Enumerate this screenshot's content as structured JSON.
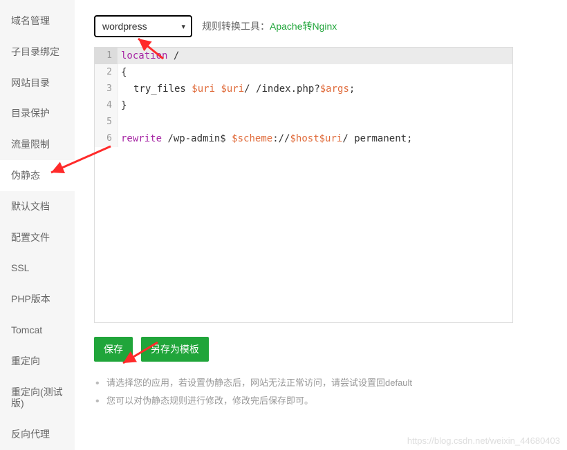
{
  "sidebar": {
    "items": [
      {
        "label": "域名管理"
      },
      {
        "label": "子目录绑定"
      },
      {
        "label": "网站目录"
      },
      {
        "label": "目录保护"
      },
      {
        "label": "流量限制"
      },
      {
        "label": "伪静态"
      },
      {
        "label": "默认文档"
      },
      {
        "label": "配置文件"
      },
      {
        "label": "SSL"
      },
      {
        "label": "PHP版本"
      },
      {
        "label": "Tomcat"
      },
      {
        "label": "重定向"
      },
      {
        "label": "重定向(测试版)"
      },
      {
        "label": "反向代理"
      }
    ],
    "active_index": 5
  },
  "top": {
    "select_value": "wordpress",
    "tool_label": "规则转换工具：",
    "tool_link": "Apache转Nginx"
  },
  "code_lines": [
    {
      "n": 1,
      "segments": [
        {
          "t": "location",
          "cls": "kw"
        },
        {
          "t": " /",
          "cls": ""
        }
      ],
      "indent": false,
      "first": true
    },
    {
      "n": 2,
      "segments": [
        {
          "t": "{",
          "cls": ""
        }
      ],
      "indent": false
    },
    {
      "n": 3,
      "segments": [
        {
          "t": "try_files ",
          "cls": ""
        },
        {
          "t": "$uri",
          "cls": "var"
        },
        {
          "t": " ",
          "cls": ""
        },
        {
          "t": "$uri",
          "cls": "var"
        },
        {
          "t": "/ /index.php?",
          "cls": ""
        },
        {
          "t": "$args",
          "cls": "var"
        },
        {
          "t": ";",
          "cls": ""
        }
      ],
      "indent": true
    },
    {
      "n": 4,
      "segments": [
        {
          "t": "}",
          "cls": ""
        }
      ],
      "indent": false
    },
    {
      "n": 5,
      "segments": [],
      "indent": false
    },
    {
      "n": 6,
      "segments": [
        {
          "t": "rewrite",
          "cls": "kw"
        },
        {
          "t": " /wp-admin$ ",
          "cls": ""
        },
        {
          "t": "$scheme",
          "cls": "var"
        },
        {
          "t": "://",
          "cls": ""
        },
        {
          "t": "$host$uri",
          "cls": "var"
        },
        {
          "t": "/ permanent;",
          "cls": ""
        }
      ],
      "indent": false
    }
  ],
  "buttons": {
    "save": "保存",
    "save_as_template": "另存为模板"
  },
  "tips": [
    "请选择您的应用，若设置伪静态后，网站无法正常访问，请尝试设置回default",
    "您可以对伪静态规则进行修改，修改完后保存即可。"
  ],
  "watermark": "https://blog.csdn.net/weixin_44680403"
}
